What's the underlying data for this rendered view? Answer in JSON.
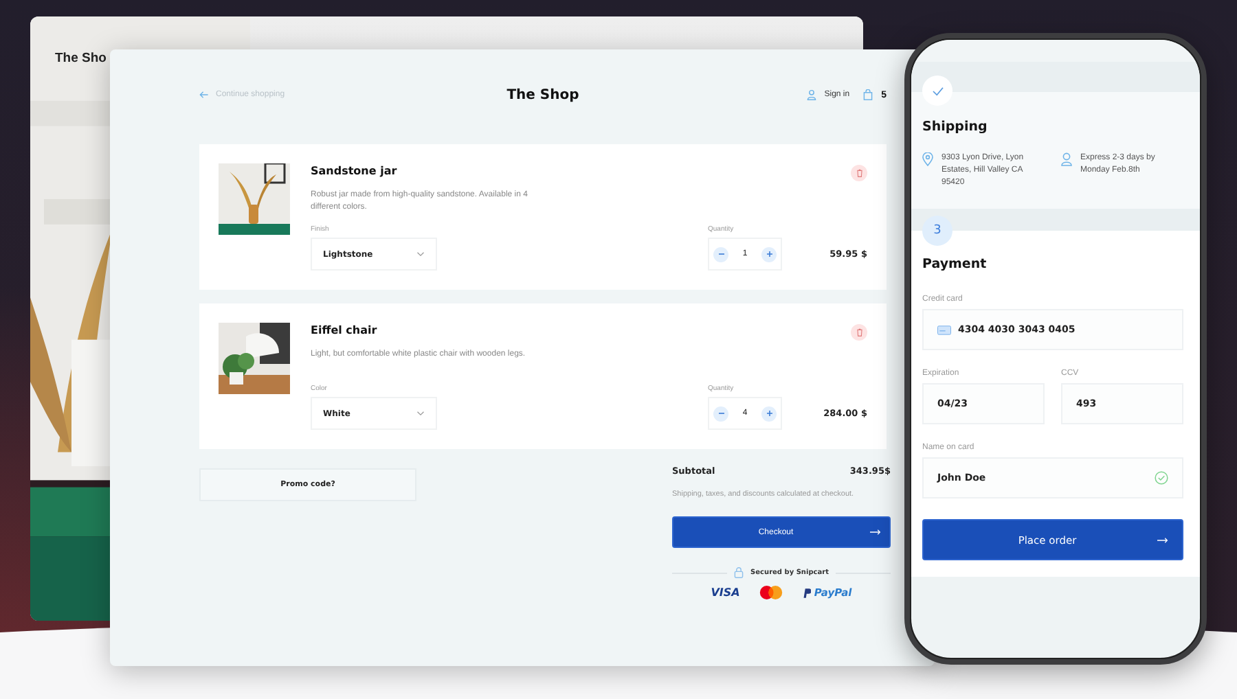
{
  "back_window": {
    "title": "The Sho"
  },
  "cart": {
    "continue_link": "Continue shopping",
    "title": "The Shop",
    "sign_in": "Sign in",
    "cart_count": "5",
    "items": [
      {
        "name": "Sandstone jar",
        "description": "Robust jar made from high-quality sandstone. Available in 4 different colors.",
        "option_label": "Finish",
        "option_value": "Lightstone",
        "quantity_label": "Quantity",
        "quantity": "1",
        "price": "59.95 $"
      },
      {
        "name": "Eiffel chair",
        "description": "Light, but comfortable white plastic chair with wooden legs.",
        "option_label": "Color",
        "option_value": "White",
        "quantity_label": "Quantity",
        "quantity": "4",
        "price": "284.00 $"
      }
    ],
    "promo": "Promo code?",
    "subtotal_label": "Subtotal",
    "subtotal": "343.95$",
    "note": "Shipping, taxes, and discounts calculated at checkout.",
    "checkout": "Checkout",
    "secured": "Secured by Snipcart",
    "payment_methods": [
      {
        "kind": "visa",
        "label": "VISA"
      },
      {
        "kind": "mastercard"
      },
      {
        "kind": "paypal",
        "label": "PayPal"
      }
    ]
  },
  "phone": {
    "shipping": {
      "completed": true,
      "title": "Shipping",
      "address": "9303 Lyon Drive, Lyon Estates, Hill Valley CA 95420",
      "delivery": "Express 2-3 days by Monday Feb.8th"
    },
    "payment": {
      "step": "3",
      "title": "Payment",
      "fields": [
        {
          "kind": "card",
          "label": "Credit card",
          "value": "4304 4030 3043 0405"
        },
        {
          "kind": "half",
          "label": "Expiration",
          "value": "04/23"
        },
        {
          "kind": "half",
          "label": "CCV",
          "value": "493"
        },
        {
          "kind": "full",
          "label": "Name on card",
          "value": "John Doe",
          "valid": true
        }
      ],
      "button": "Place order"
    }
  }
}
